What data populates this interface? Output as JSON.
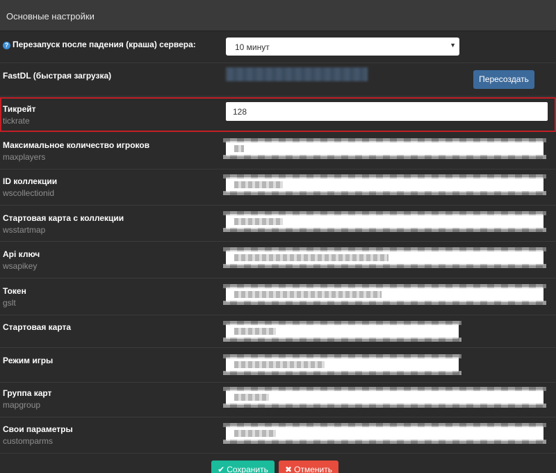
{
  "panel": {
    "title": "Основные настройки"
  },
  "restart": {
    "label": "Перезапуск после падения (краша) сервера:",
    "selected": "10 минут",
    "icon": "question-circle-icon"
  },
  "fastdl": {
    "label": "FastDL (быстрая загрузка)",
    "button_label": "Пересоздать"
  },
  "fields": [
    {
      "label": "Тикрейт",
      "key": "tickrate",
      "value": "128"
    },
    {
      "label": "Максимальное количество игроков",
      "key": "maxplayers",
      "value": ""
    },
    {
      "label": "ID коллекции",
      "key": "wscollectionid",
      "value": ""
    },
    {
      "label": "Стартовая карта с коллекции",
      "key": "wsstartmap",
      "value": ""
    },
    {
      "label": "Api ключ",
      "key": "wsapikey",
      "value": ""
    },
    {
      "label": "Токен",
      "key": "gslt",
      "value": ""
    },
    {
      "label": "Стартовая карта",
      "key": "",
      "value": ""
    },
    {
      "label": "Режим игры",
      "key": "",
      "value": ""
    },
    {
      "label": "Группа карт",
      "key": "mapgroup",
      "value": ""
    },
    {
      "label": "Свои параметры",
      "key": "customparms",
      "value": ""
    }
  ],
  "actions": {
    "save_label": "Сохранить",
    "cancel_label": "Отменить",
    "save_icon": "check-icon",
    "cancel_icon": "times-icon"
  },
  "colors": {
    "save": "#1abc9c",
    "cancel": "#e74c3c",
    "recreate": "#3c6a9b",
    "highlight": "#c41e25"
  }
}
